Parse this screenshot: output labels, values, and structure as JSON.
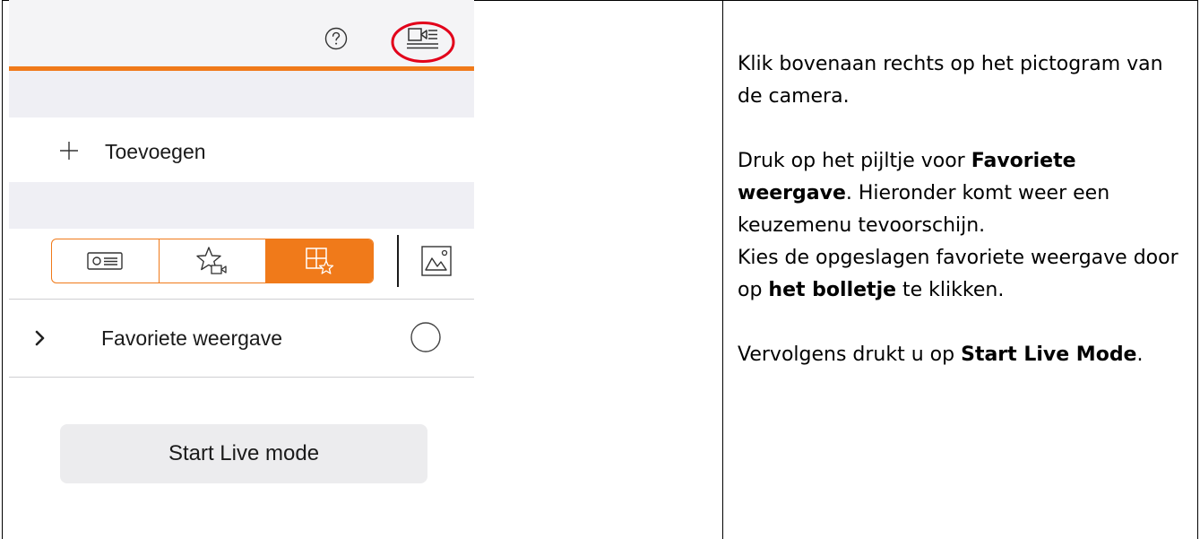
{
  "app": {
    "add_label": "Toevoegen",
    "favorite_label": "Favoriete weergave",
    "start_button_label": "Start Live mode",
    "icons": {
      "help": "help-icon",
      "camera": "camera-list-icon",
      "plus": "plus-icon",
      "segment_device": "device-icon",
      "segment_favorites": "star-camera-icon",
      "segment_grid": "grid-star-icon",
      "image": "image-icon",
      "chevron": "chevron-right-icon",
      "radio": "radio-circle-icon"
    },
    "segments": [
      {
        "name": "device",
        "selected": false
      },
      {
        "name": "favorites",
        "selected": false
      },
      {
        "name": "grid-favorites",
        "selected": true
      }
    ],
    "highlight_color": "#e2001a",
    "accent_color": "#f07a1a"
  },
  "instructions": {
    "p1": "Klik bovenaan rechts op het pictogram van de camera.",
    "p2_pre": "Druk op het pijltje voor ",
    "p2_bold1": "Favoriete weergave",
    "p2_mid": ". Hieronder komt weer een keuzemenu tevoorschijn.",
    "p2_line2_pre": "Kies de opgeslagen favoriete weergave door op ",
    "p2_bold2": "het bolletje",
    "p2_post": " te klikken.",
    "p3_pre": "Vervolgens drukt u op ",
    "p3_bold": "Start Live Mode",
    "p3_post": "."
  }
}
